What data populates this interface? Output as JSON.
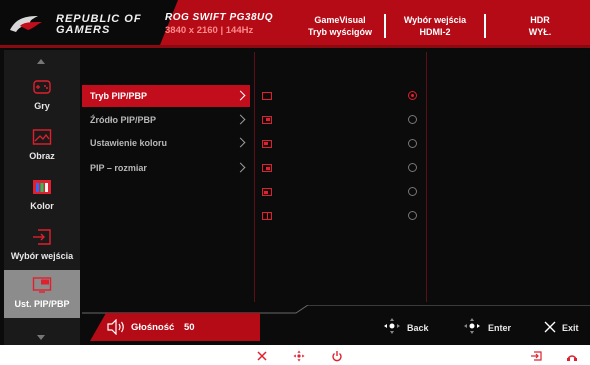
{
  "header": {
    "brand_line1": "REPUBLIC OF",
    "brand_line2": "GAMERS",
    "model": "ROG SWIFT PG38UQ",
    "resolution": "3840 x 2160 | 144Hz",
    "gamevisual_label": "GameVisual",
    "gamevisual_value": "Tryb wyścigów",
    "input_label": "Wybór wejścia",
    "input_value": "HDMI-2",
    "hdr_label": "HDR",
    "hdr_value": "WYŁ."
  },
  "sidebar": {
    "items": [
      {
        "label": "Gry",
        "icon": "gamepad-icon"
      },
      {
        "label": "Obraz",
        "icon": "image-icon"
      },
      {
        "label": "Kolor",
        "icon": "color-bars-icon"
      },
      {
        "label": "Wybór wejścia",
        "icon": "input-select-icon"
      },
      {
        "label": "Ust. PIP/PBP",
        "icon": "pip-monitor-icon"
      }
    ]
  },
  "menu": {
    "items": [
      {
        "label": "Tryb PIP/PBP"
      },
      {
        "label": "Źródło PIP/PBP"
      },
      {
        "label": "Ustawienie koloru"
      },
      {
        "label": "PIP – rozmiar"
      }
    ]
  },
  "options": {
    "selected_index": 0,
    "items": [
      {
        "icon": "pip-off-icon"
      },
      {
        "icon": "pip-top-right-icon"
      },
      {
        "icon": "pip-top-left-icon"
      },
      {
        "icon": "pip-bottom-right-icon"
      },
      {
        "icon": "pip-bottom-left-icon"
      },
      {
        "icon": "pbp-split-icon"
      }
    ]
  },
  "footer": {
    "volume_label": "Głośność",
    "volume_value": "50",
    "back_label": "Back",
    "enter_label": "Enter",
    "exit_label": "Exit"
  },
  "colors": {
    "accent": "#c20d1c",
    "header_red": "#b50b17",
    "background": "#0b0b0b",
    "sidebar_active": "#8c8c8c"
  }
}
